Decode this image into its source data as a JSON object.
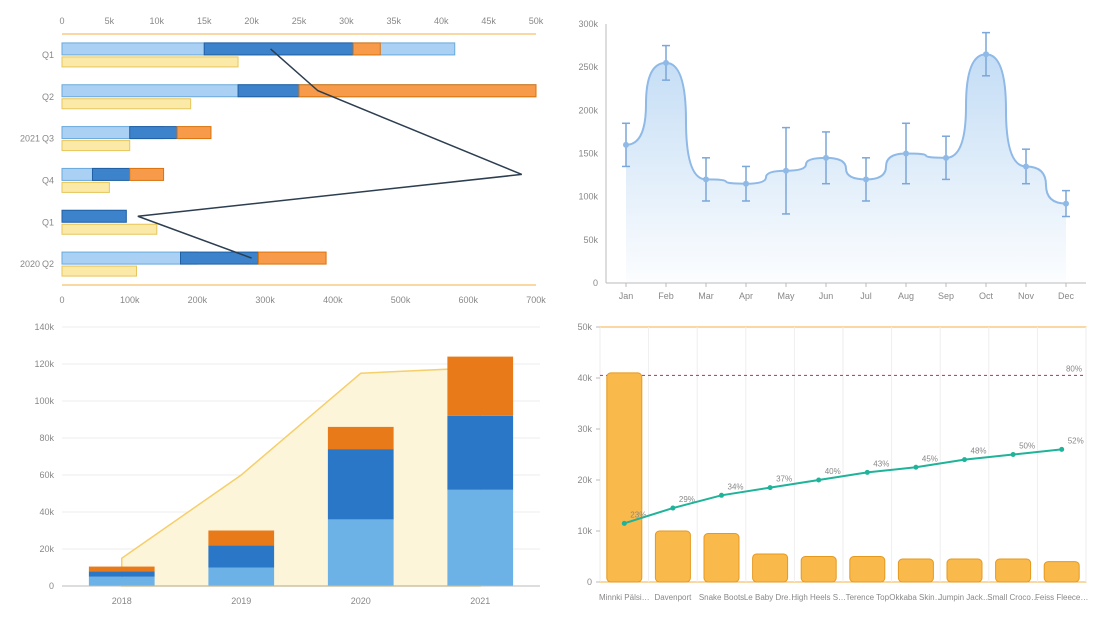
{
  "chart_data": [
    {
      "id": "topLeft",
      "type": "bar",
      "orientation": "horizontal",
      "title": "",
      "axes": {
        "bottom": {
          "min": 0,
          "max": 700000,
          "step": 100000,
          "format": "k",
          "label": ""
        },
        "top": {
          "min": 0,
          "max": 50000,
          "step": 5000,
          "format": "k",
          "label": ""
        }
      },
      "rows": [
        {
          "group": "",
          "label": "Q1",
          "light": 580000,
          "mid": [
            210000,
            430000
          ],
          "orange": [
            430000,
            470000
          ],
          "yellow": 260000,
          "lineX": 22000
        },
        {
          "group": "",
          "label": "Q2",
          "light": 700000,
          "mid": [
            260000,
            350000
          ],
          "orange": [
            350000,
            700000
          ],
          "yellow": 190000,
          "lineX": 27000
        },
        {
          "group": "2021",
          "label": "Q3",
          "light": 150000,
          "mid": [
            100000,
            170000
          ],
          "orange": [
            170000,
            220000
          ],
          "yellow": 100000,
          "lineX": null
        },
        {
          "group": "",
          "label": "Q4",
          "light": 70000,
          "mid": [
            45000,
            100000
          ],
          "orange": [
            100000,
            150000
          ],
          "yellow": 70000,
          "lineX": 48500
        },
        {
          "group": "",
          "label": "Q1",
          "light": 0,
          "mid": [
            0,
            95000
          ],
          "orange": [
            0,
            0
          ],
          "yellow": 140000,
          "lineX": 8000
        },
        {
          "group": "2020",
          "label": "Q2",
          "light": 200000,
          "mid": [
            175000,
            290000
          ],
          "orange": [
            290000,
            390000
          ],
          "yellow": 110000,
          "lineX": 20000
        }
      ]
    },
    {
      "id": "topRight",
      "type": "area",
      "title": "",
      "xlabels": [
        "Jan",
        "Feb",
        "Mar",
        "Apr",
        "May",
        "Jun",
        "Jul",
        "Aug",
        "Sep",
        "Oct",
        "Nov",
        "Dec"
      ],
      "ylim": [
        0,
        300000
      ],
      "ystep": 50000,
      "yformat": "k",
      "values": [
        160000,
        255000,
        120000,
        115000,
        130000,
        145000,
        120000,
        150000,
        145000,
        265000,
        135000,
        92000
      ],
      "err": [
        25000,
        20000,
        25000,
        20000,
        50000,
        30000,
        25000,
        35000,
        25000,
        25000,
        20000,
        15000
      ]
    },
    {
      "id": "bottomLeft",
      "type": "bar",
      "stacked": true,
      "title": "",
      "categories": [
        "2018",
        "2019",
        "2020",
        "2021"
      ],
      "ylim": [
        0,
        140000
      ],
      "ystep": 20000,
      "yformat": "k",
      "series": [
        {
          "name": "light",
          "color": "#6cb2e6",
          "values": [
            5000,
            10000,
            36000,
            52000
          ]
        },
        {
          "name": "mid",
          "color": "#2a77c7",
          "values": [
            3000,
            12000,
            38000,
            40000
          ]
        },
        {
          "name": "orange",
          "color": "#e87a1a",
          "values": [
            2500,
            8000,
            12000,
            32000
          ]
        }
      ],
      "line": {
        "name": "target",
        "color": "#f5cf6a",
        "values": [
          15000,
          60000,
          115000,
          118000
        ]
      }
    },
    {
      "id": "bottomRight",
      "type": "bar",
      "title": "",
      "categories": [
        "Minnki Pälsi…",
        "Davenport",
        "Snake Boots",
        "Le Baby Dre…",
        "High Heels S…",
        "Terence Top",
        "Okkaba Skin…",
        "Jumpin Jack…",
        "Small Croco…",
        "Feiss Fleece…"
      ],
      "ylim": [
        0,
        5000000
      ],
      "ystep": 1000000,
      "yformat": "M",
      "bars": [
        4100000,
        1000000,
        950000,
        550000,
        500000,
        500000,
        450000,
        450000,
        450000,
        400000
      ],
      "threshold": {
        "value": 4050000,
        "label": "80%",
        "color": "#d13b7b"
      },
      "cumulative": {
        "color": "#1fb39a",
        "labels": [
          "23%",
          "29%",
          "34%",
          "37%",
          "40%",
          "43%",
          "45%",
          "48%",
          "50%",
          "52%"
        ],
        "values": [
          1150000,
          1450000,
          1700000,
          1850000,
          2000000,
          2150000,
          2250000,
          2400000,
          2500000,
          2600000
        ]
      }
    }
  ]
}
